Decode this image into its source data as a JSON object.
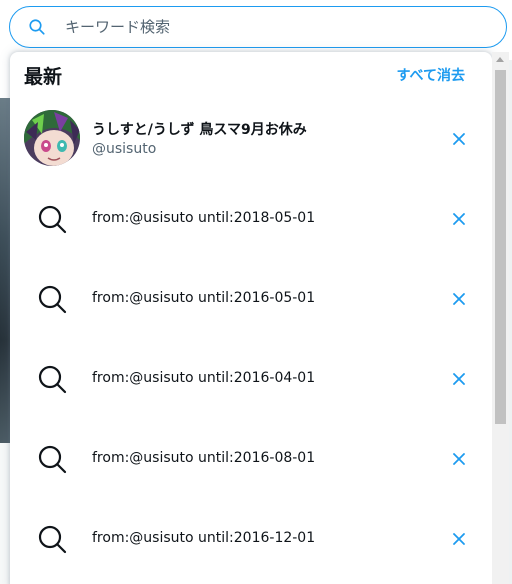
{
  "search": {
    "placeholder": "キーワード検索",
    "value": ""
  },
  "dropdown": {
    "title": "最新",
    "clear_all_label": "すべて消去"
  },
  "recent_user": {
    "display_name": "うしすと/うしず 鳥スマ9月お休み",
    "handle": "@usisuto"
  },
  "recent_searches": [
    {
      "query": "from:@usisuto until:2018-05-01"
    },
    {
      "query": "from:@usisuto until:2016-05-01"
    },
    {
      "query": "from:@usisuto until:2016-04-01"
    },
    {
      "query": "from:@usisuto until:2016-08-01"
    },
    {
      "query": "from:@usisuto until:2016-12-01"
    }
  ],
  "colors": {
    "accent": "#1d9bf0",
    "text_primary": "#0f1419",
    "text_secondary": "#536471"
  },
  "icons": {
    "search": "search-icon",
    "remove": "close-icon"
  }
}
